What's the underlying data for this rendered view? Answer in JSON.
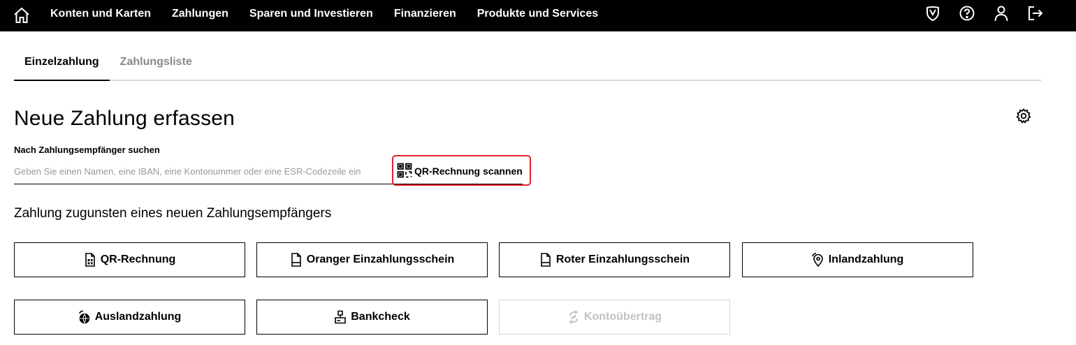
{
  "nav": {
    "home_icon": "home-icon",
    "links": [
      {
        "label": "Konten und Karten"
      },
      {
        "label": "Zahlungen"
      },
      {
        "label": "Sparen und Investieren"
      },
      {
        "label": "Finanzieren"
      },
      {
        "label": "Produkte und Services"
      }
    ],
    "icons": [
      "shield-icon",
      "help-icon",
      "user-icon",
      "logout-icon"
    ]
  },
  "tabs": [
    {
      "label": "Einzelzahlung",
      "active": true
    },
    {
      "label": "Zahlungsliste",
      "active": false
    }
  ],
  "page": {
    "title": "Neue Zahlung erfassen",
    "settings_icon": "gear-icon"
  },
  "search": {
    "label": "Nach Zahlungsempfänger suchen",
    "placeholder": "Geben Sie einen Namen, eine IBAN, eine Kontonummer oder eine ESR-Codezeile ein",
    "value": "",
    "scan_label": "QR-Rechnung scannen",
    "scan_icon": "qr-scan-icon"
  },
  "new_payee": {
    "heading": "Zahlung zugunsten eines neuen Zahlungsempfängers",
    "buttons": [
      {
        "label": "QR-Rechnung",
        "icon": "qr-bill-icon",
        "enabled": true
      },
      {
        "label": "Oranger Einzahlungsschein",
        "icon": "document-icon",
        "enabled": true
      },
      {
        "label": "Roter Einzahlungsschein",
        "icon": "document-icon",
        "enabled": true
      },
      {
        "label": "Inlandzahlung",
        "icon": "location-pin-icon",
        "enabled": true
      },
      {
        "label": "Auslandzahlung",
        "icon": "globe-icon",
        "enabled": true
      },
      {
        "label": "Bankcheck",
        "icon": "cheque-icon",
        "enabled": true
      },
      {
        "label": "Kontoübertrag",
        "icon": "transfer-icon",
        "enabled": false
      }
    ]
  },
  "colors": {
    "nav_background": "#000000",
    "highlight_border": "#e0232d",
    "tab_inactive": "#888888",
    "disabled": "#c2c2c2"
  }
}
